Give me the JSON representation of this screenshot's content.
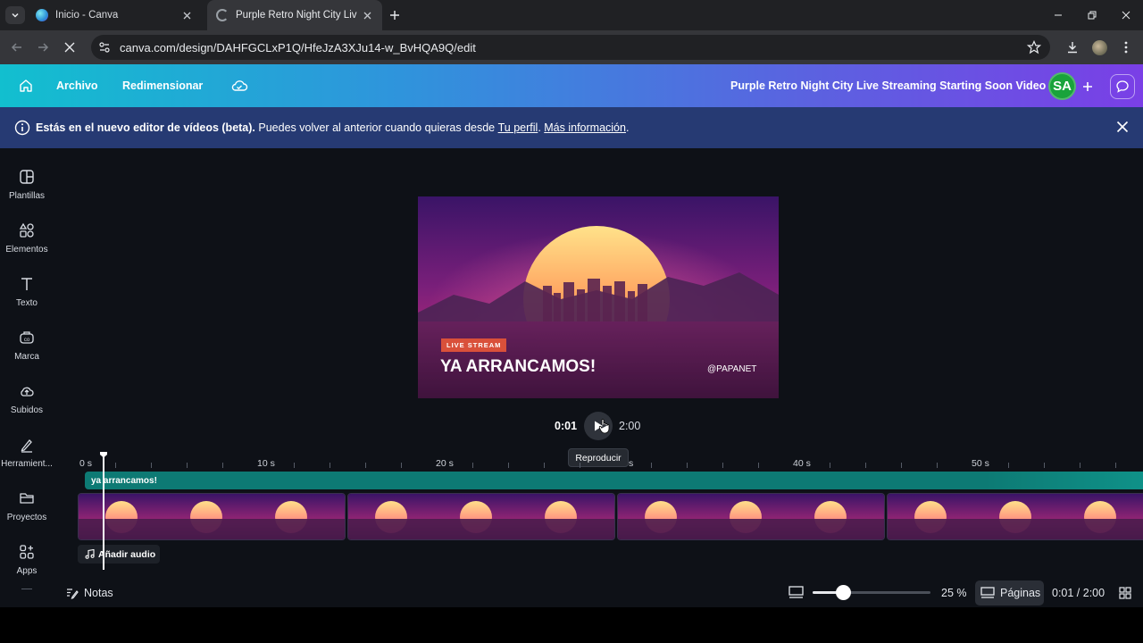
{
  "browser": {
    "tabs": [
      {
        "title": "Inicio - Canva",
        "active": false
      },
      {
        "title": "Purple Retro Night City Live Stre",
        "active": true
      }
    ],
    "url": "canva.com/design/DAHFGCLxP1Q/HfeJzA3XJu14-w_BvHQA9Q/edit"
  },
  "topbar": {
    "menu": [
      "Archivo",
      "Redimensionar"
    ],
    "design_title": "Purple Retro Night City Live Streaming Starting Soon Video",
    "avatar_initials": "SA"
  },
  "banner": {
    "bold": "Estás en el nuevo editor de vídeos (beta).",
    "text": " Puedes volver al anterior cuando quieras desde ",
    "link1": "Tu perfil",
    "sep": ". ",
    "link2": "Más información",
    "end": "."
  },
  "sidebar": {
    "items": [
      {
        "label": "Plantillas",
        "icon": "templates-icon"
      },
      {
        "label": "Elementos",
        "icon": "elements-icon"
      },
      {
        "label": "Texto",
        "icon": "text-icon"
      },
      {
        "label": "Marca",
        "icon": "brand-icon"
      },
      {
        "label": "Subidos",
        "icon": "upload-icon"
      },
      {
        "label": "Herramient...",
        "icon": "tools-icon"
      },
      {
        "label": "Proyectos",
        "icon": "folder-icon"
      },
      {
        "label": "Apps",
        "icon": "apps-icon"
      }
    ]
  },
  "canvas": {
    "badge": "LIVE STREAM",
    "headline": "YA ARRANCAMOS!",
    "handle": "@PAPANET"
  },
  "player": {
    "current": "0:01",
    "total": "2:00",
    "tooltip": "Reproducir"
  },
  "timeline": {
    "ruler_labels": [
      "0 s",
      "10 s",
      "20 s",
      "s",
      "40 s",
      "50 s"
    ],
    "text_track_label": "ya arrancamos!",
    "add_audio": "Añadir audio",
    "playhead_seconds": 1
  },
  "bottom": {
    "notes": "Notas",
    "zoom": "25 %",
    "zoom_level": 0.25,
    "pages": "Páginas",
    "counter": "0:01 / 2:00"
  },
  "colors": {
    "accent_teal": "#0d7a74",
    "banner_bg": "#263a73",
    "avatar_bg": "#19a33b"
  }
}
